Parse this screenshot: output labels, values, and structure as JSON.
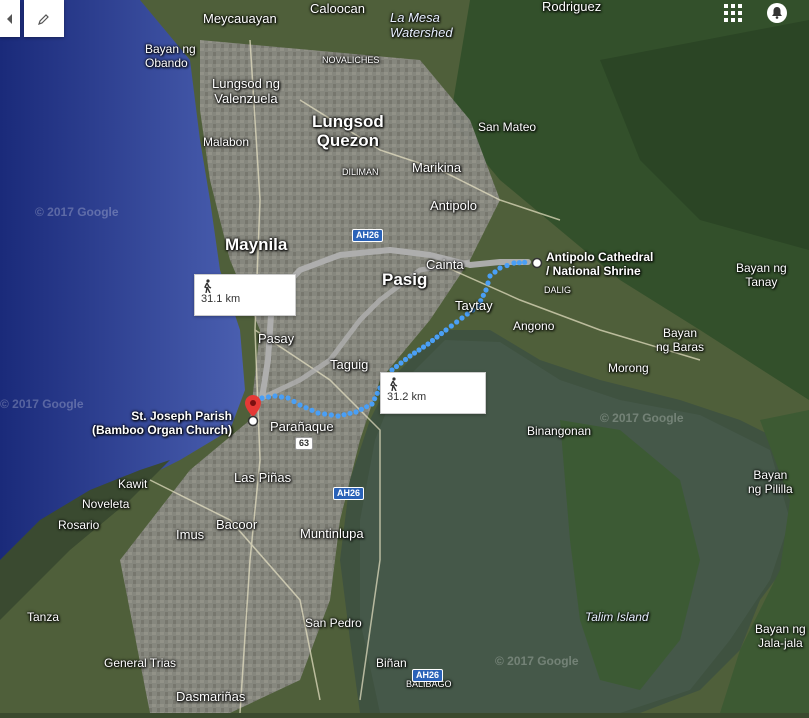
{
  "map": {
    "watermark": "© 2017 Google",
    "labels": {
      "caloocan": "Caloocan",
      "la_mesa": "La Mesa\nWatershed",
      "rodriguez": "Rodriguez",
      "meycauayan": "Meycauayan",
      "bayan_obando": "Bayan ng\nObando",
      "novaliches": "NOVALICHES",
      "valenzuela": "Lungsod ng\nValenzuela",
      "quezon": "Lungsod\nQuezon",
      "san_mateo": "San Mateo",
      "malabon": "Malabon",
      "diliman": "DILIMAN",
      "marikina": "Marikina",
      "antipolo": "Antipolo",
      "maynila": "Maynila",
      "pasig": "Pasig",
      "cainta": "Cainta",
      "dalig": "DALIG",
      "bayan_tanay": "Bayan ng\nTanay",
      "taytay": "Taytay",
      "angono": "Angono",
      "pasay": "Pasay",
      "bayan_baras": "Bayan\nng Baras",
      "morong": "Morong",
      "taguig": "Taguig",
      "paranaque": "Parañaque",
      "binangonan": "Binangonan",
      "bayan_pililla": "Bayan\nng Pililla",
      "kawit": "Kawit",
      "las_pinas": "Las Piñas",
      "noveleta": "Noveleta",
      "rosario": "Rosario",
      "bacoor": "Bacoor",
      "imus": "Imus",
      "muntinlupa": "Muntinlupa",
      "tanza": "Tanza",
      "talim_island": "Talim Island",
      "san_pedro": "San Pedro",
      "bayan_jalajala": "Bayan ng\nJala-jala",
      "general_trias": "General Trias",
      "binan": "Biñan",
      "balibago": "BALIBAGO",
      "dasmarinas": "Dasmariñas"
    },
    "shields": {
      "ah26_north": "AH26",
      "ah26_mid": "AH26",
      "ah26_south": "AH26",
      "r63": "63"
    }
  },
  "route": {
    "origin": "St. Joseph Parish\n(Bamboo Organ Church)",
    "destination": "Antipolo Cathedral\n/ National Shrine",
    "option_selected": "31.2 km",
    "option_alternate": "31.1 km",
    "mode": "walking",
    "colors": {
      "selected": "#4a9ff5",
      "alternate": "#b0b0b0",
      "pin": "#e53935"
    }
  },
  "controls": {
    "collapse_icon": "chevron-left-icon",
    "edit_icon": "pencil-icon",
    "apps_icon": "apps-grid-icon",
    "notifications_icon": "bell-icon"
  }
}
